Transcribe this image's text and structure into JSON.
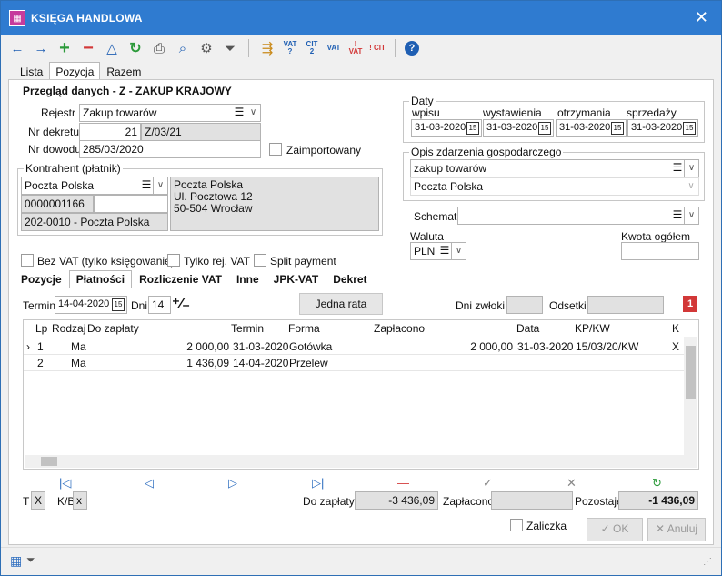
{
  "window": {
    "title": "KSIĘGA HANDLOWA",
    "close": "✕"
  },
  "toolbar": {
    "back": "←",
    "forward": "→",
    "add": "+",
    "remove": "−",
    "warning": "△",
    "refresh": "↻",
    "print": "⎙",
    "search": "⌕",
    "settings": "⚙",
    "filter": "⏷",
    "bookmark": "⇶",
    "vat_q": "VAT ?",
    "cit2": "CIT 2",
    "zvat": "VAT",
    "vat_excl": "! VAT",
    "cit_excl": "! CIT",
    "help": "?"
  },
  "top_tabs": [
    "Lista",
    "Pozycja",
    "Razem"
  ],
  "section_title": "Przegląd danych - Z - ZAKUP KRAJOWY",
  "rejestr": {
    "label": "Rejestr",
    "value": "Zakup towarów"
  },
  "nr_dekretu": {
    "label": "Nr dekretu",
    "num": "21",
    "value": "Z/03/21"
  },
  "nr_dowodu": {
    "label": "Nr dowodu",
    "value": "285/03/2020"
  },
  "zaimportowany": "Zaimportowany",
  "kontrahent": {
    "legend": "Kontrahent (płatnik)",
    "name": "Poczta Polska",
    "code": "0000001166",
    "account": "202-0010 - Poczta Polska",
    "addr1": "Poczta Polska",
    "addr2": "Ul. Pocztowa 12",
    "addr3": "50-504 Wrocław"
  },
  "daty": {
    "legend": "Daty",
    "labels": [
      "wpisu",
      "wystawienia",
      "otrzymania",
      "sprzedaży"
    ],
    "values": [
      "31-03-2020",
      "31-03-2020",
      "31-03-2020",
      "31-03-2020"
    ]
  },
  "opis": {
    "legend": "Opis zdarzenia gospodarczego",
    "value1": "zakup towarów",
    "value2": "Poczta Polska"
  },
  "schemat": {
    "label": "Schemat",
    "value": ""
  },
  "waluta": {
    "label": "Waluta",
    "value": "PLN"
  },
  "kwota": {
    "label": "Kwota ogółem",
    "value": ""
  },
  "checks": {
    "bez_vat": "Bez VAT (tylko księgowanie)",
    "tylko_rej": "Tylko rej. VAT",
    "split": "Split payment"
  },
  "sub_tabs": [
    "Pozycje",
    "Płatności",
    "Rozliczenie VAT",
    "Inne",
    "JPK-VAT",
    "Dekret"
  ],
  "platnosci": {
    "termin_label": "Termin",
    "termin_value": "14-04-2020",
    "dni_label": "Dni",
    "dni_value": "14",
    "jedna_rata": "Jedna rata",
    "dni_zwloki": "Dni zwłoki",
    "odsetki": "Odsetki"
  },
  "grid": {
    "headers": [
      "Lp",
      "Rodzaj",
      "Do zapłaty",
      "Termin",
      "Forma",
      "Zapłacono",
      "Data",
      "KP/KW",
      "K"
    ],
    "rows": [
      [
        "1",
        "Ma",
        "2 000,00",
        "31-03-2020",
        "Gotówka",
        "2 000,00",
        "31-03-2020",
        "15/03/20/KW",
        "X"
      ],
      [
        "2",
        "Ma",
        "1 436,09",
        "14-04-2020",
        "Przelew",
        "",
        "",
        "",
        ""
      ]
    ]
  },
  "nav": {
    "first": "|◁",
    "prev": "◁",
    "next": "▷",
    "last": "▷|",
    "minus": "—",
    "ok": "✓",
    "cancel": "✕",
    "refresh": "↻"
  },
  "bottom": {
    "t_label": "T",
    "t_value": "X",
    "kb_label": "K/B",
    "kb_value": "x",
    "do_zaplaty_label": "Do zapłaty",
    "do_zaplaty": "-3 436,09",
    "zaplacono_label": "Zapłacono",
    "zaplacono": "",
    "pozostaje_label": "Pozostaje",
    "pozostaje": "-1 436,09"
  },
  "zaliczka": "Zaliczka",
  "buttons": {
    "ok": "OK",
    "anuluj": "Anuluj"
  },
  "colors": {
    "titlebar": "#2f7bd0",
    "accent_red": "#d23838",
    "accent_green": "#2b9a3a"
  }
}
